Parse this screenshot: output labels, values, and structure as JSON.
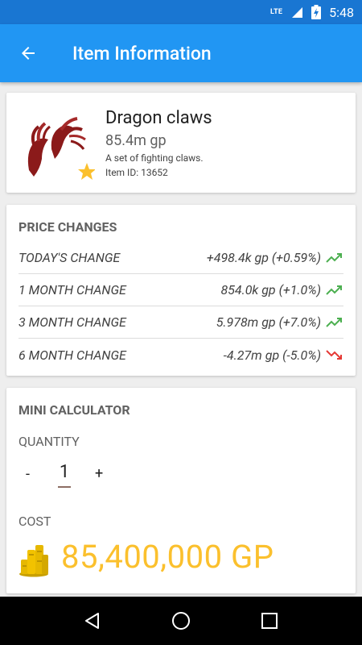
{
  "status_bar": {
    "network": "LTE",
    "time": "5:48"
  },
  "app_bar": {
    "title": "Item Information",
    "back_icon": "arrow-back-icon"
  },
  "item": {
    "name": "Dragon claws",
    "price": "85.4m gp",
    "description": "A set of fighting claws.",
    "item_id": "Item ID: 13652",
    "favorite_color": "#fbc02d"
  },
  "price_changes": {
    "title": "PRICE CHANGES",
    "rows": [
      {
        "label": "TODAY'S CHANGE",
        "value": "+498.4k gp (+0.59%)",
        "trend": "up"
      },
      {
        "label": "1 MONTH CHANGE",
        "value": "854.0k gp (+1.0%)",
        "trend": "up"
      },
      {
        "label": "3 MONTH CHANGE",
        "value": "5.978m gp (+7.0%)",
        "trend": "up"
      },
      {
        "label": "6 MONTH CHANGE",
        "value": "-4.27m gp (-5.0%)",
        "trend": "down"
      }
    ],
    "colors": {
      "up": "#4caf50",
      "down": "#e53935"
    }
  },
  "calculator": {
    "title": "MINI CALCULATOR",
    "quantity_label": "QUANTITY",
    "minus_label": "-",
    "quantity": "1",
    "plus_label": "+",
    "cost_label": "COST",
    "cost_value": "85,400,000 GP"
  },
  "colors": {
    "primary": "#2196f3",
    "primary_dark": "#1976d2",
    "accent": "#fbc02d"
  }
}
